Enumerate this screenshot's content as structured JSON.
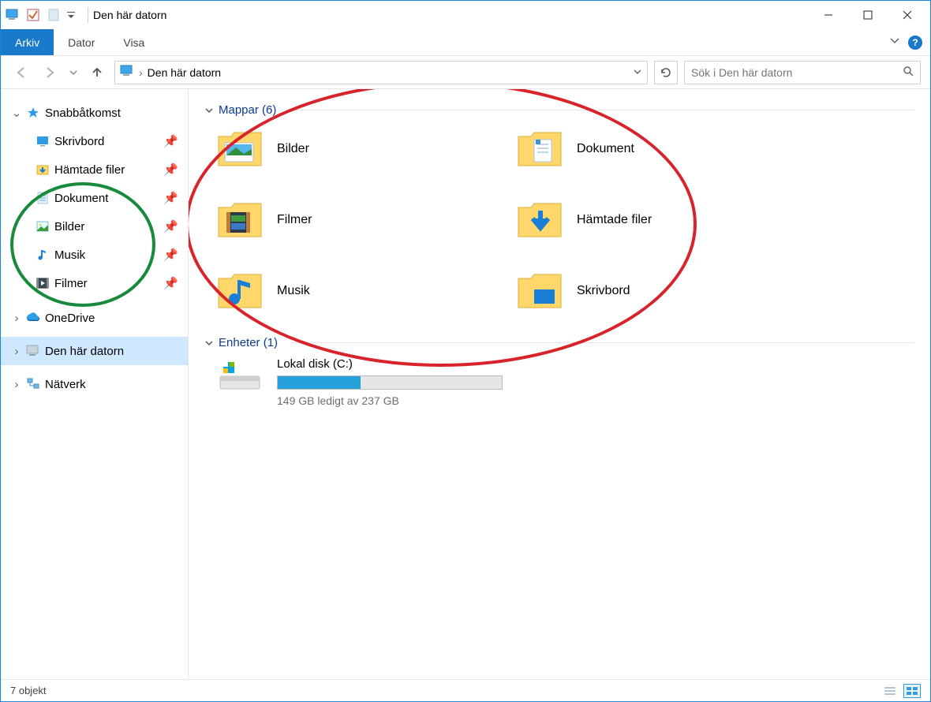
{
  "window": {
    "title": "Den här datorn"
  },
  "ribbon": {
    "tabs": {
      "arkiv": "Arkiv",
      "dator": "Dator",
      "visa": "Visa"
    }
  },
  "address": {
    "label": "Den här datorn"
  },
  "search": {
    "placeholder": "Sök i Den här datorn"
  },
  "sidebar": {
    "quick": "Snabbåtkomst",
    "items": [
      {
        "label": "Skrivbord"
      },
      {
        "label": "Hämtade filer"
      },
      {
        "label": "Dokument"
      },
      {
        "label": "Bilder"
      },
      {
        "label": "Musik"
      },
      {
        "label": "Filmer"
      }
    ],
    "onedrive": "OneDrive",
    "thispc": "Den här datorn",
    "network": "Nätverk"
  },
  "sections": {
    "folders_title": "Mappar (6)",
    "drives_title": "Enheter (1)"
  },
  "folders": [
    {
      "label": "Bilder"
    },
    {
      "label": "Dokument"
    },
    {
      "label": "Filmer"
    },
    {
      "label": "Hämtade filer"
    },
    {
      "label": "Musik"
    },
    {
      "label": "Skrivbord"
    }
  ],
  "drive": {
    "name": "Lokal disk (C:)",
    "free_text": "149 GB ledigt av 237 GB",
    "used_percent": 37
  },
  "statusbar": {
    "objects": "7 objekt"
  }
}
